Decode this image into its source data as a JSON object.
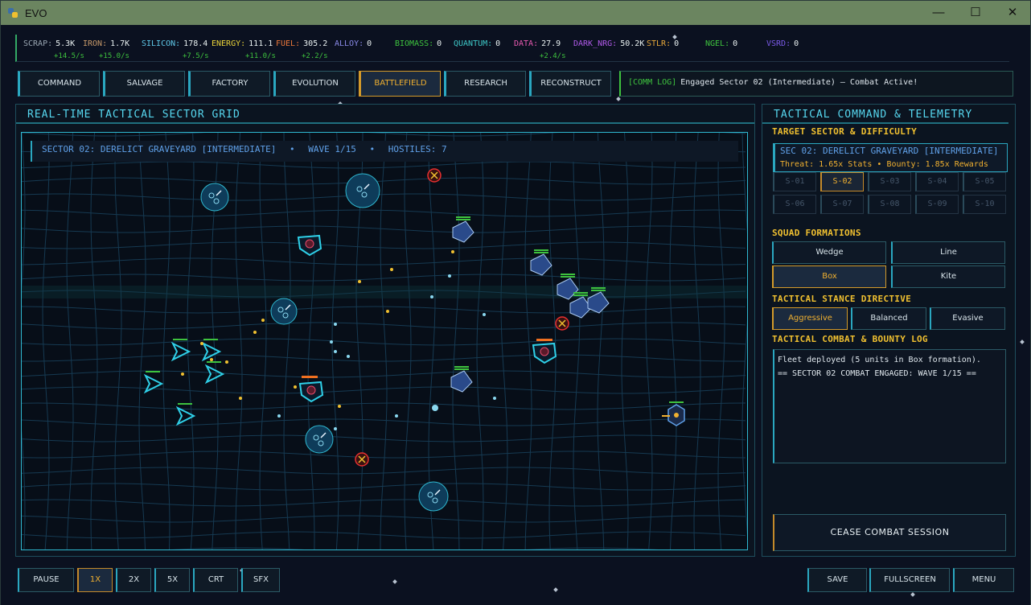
{
  "window": {
    "title": "EVO",
    "minimize": "—",
    "maximize": "☐",
    "close": "✕"
  },
  "resources": [
    {
      "name": "SCRAP:",
      "value": "5.3K",
      "rate": "+14.5/s",
      "color": "#9aa6b2"
    },
    {
      "name": "IRON:",
      "value": "1.7K",
      "rate": "+15.0/s",
      "color": "#c89a6a"
    },
    {
      "name": "SILICON:",
      "value": "178.4",
      "rate": "+7.5/s",
      "color": "#5fc8e8"
    },
    {
      "name": "ENERGY:",
      "value": "111.1",
      "rate": "+11.0/s",
      "color": "#e8d23a"
    },
    {
      "name": "FUEL:",
      "value": "305.2",
      "rate": "+2.2/s",
      "color": "#e8763a"
    },
    {
      "name": "ALLOY:",
      "value": "0",
      "rate": "",
      "color": "#8a8ae8"
    },
    {
      "name": "BIOMASS:",
      "value": "0",
      "rate": "",
      "color": "#3ec23e"
    },
    {
      "name": "QUANTUM:",
      "value": "0",
      "rate": "",
      "color": "#3ec8c8"
    },
    {
      "name": "DATA:",
      "value": "27.9",
      "rate": "+2.4/s",
      "color": "#e85ab0"
    },
    {
      "name": "DARK_NRG:",
      "value": "50.2K",
      "rate": "",
      "color": "#b05ae8"
    },
    {
      "name": "STLR:",
      "value": "0",
      "rate": "",
      "color": "#e8a83a"
    },
    {
      "name": "NGEL:",
      "value": "0",
      "rate": "",
      "color": "#3ec23e"
    },
    {
      "name": "VSRD:",
      "value": "0",
      "rate": "",
      "color": "#7a5ae8"
    }
  ],
  "tabs": [
    "COMMAND",
    "SALVAGE",
    "FACTORY",
    "EVOLUTION",
    "BATTLEFIELD",
    "RESEARCH",
    "RECONSTRUCT"
  ],
  "comm_log": {
    "tag": "[COMM LOG]",
    "text": "Engaged Sector 02 (Intermediate) — Combat Active!"
  },
  "grid": {
    "title": "REAL-TIME TACTICAL SECTOR GRID",
    "sector": "SECTOR 02: DERELICT GRAVEYARD [INTERMEDIATE]",
    "sep": "•",
    "wave": "WAVE 1/15",
    "hostiles": "HOSTILES: 7"
  },
  "telemetry": {
    "title": "TACTICAL COMMAND & TELEMETRY",
    "target_label": "TARGET SECTOR & DIFFICULTY",
    "selected_sector": "SEC 02: DERELICT GRAVEYARD [INTERMEDIATE]",
    "sector_stats": "Threat: 1.65x Stats  •  Bounty: 1.85x Rewards",
    "sectors": [
      "S-01",
      "S-02",
      "S-03",
      "S-04",
      "S-05",
      "S-06",
      "S-07",
      "S-08",
      "S-09",
      "S-10"
    ],
    "formations_label": "SQUAD FORMATIONS",
    "formations": [
      "Wedge",
      "Line",
      "Box",
      "Kite"
    ],
    "stance_label": "TACTICAL STANCE DIRECTIVE",
    "stances": [
      "Aggressive",
      "Balanced",
      "Evasive"
    ],
    "log_label": "TACTICAL COMBAT & BOUNTY LOG",
    "log": [
      "Fleet deployed (5 units in Box formation).",
      "== SECTOR 02 COMBAT ENGAGED: WAVE 1/15 =="
    ],
    "cease": "CEASE COMBAT SESSION"
  },
  "bottom": {
    "left": [
      "PAUSE",
      "1X",
      "2X",
      "5X",
      "CRT",
      "SFX"
    ],
    "right": [
      "SAVE",
      "FULLSCREEN",
      "MENU"
    ]
  }
}
